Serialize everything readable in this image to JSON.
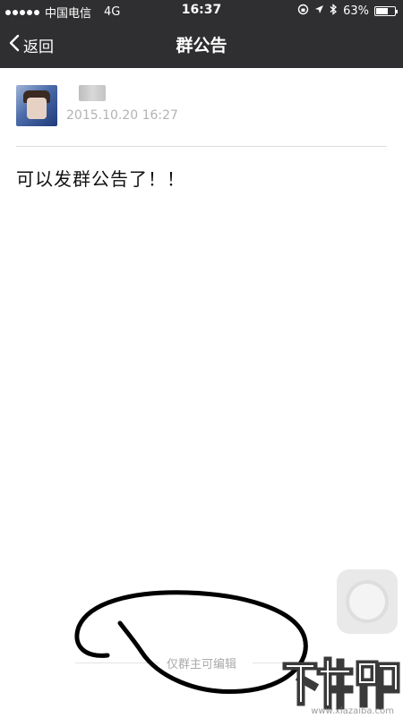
{
  "status_bar": {
    "carrier": "中国电信",
    "network": "4G",
    "time": "16:37",
    "battery_text": "63%",
    "battery_level": 0.63
  },
  "nav": {
    "back_label": "返回",
    "title": "群公告"
  },
  "post": {
    "timestamp": "2015.10.20  16:27",
    "message": "可以发群公告了！！"
  },
  "footer": {
    "note": "仅群主可编辑"
  },
  "watermark": {
    "logo_text": "下载吧",
    "url": "www.xiazaiba.com"
  },
  "colors": {
    "top_bar": "#2f2f31",
    "annotation": "#000000"
  }
}
